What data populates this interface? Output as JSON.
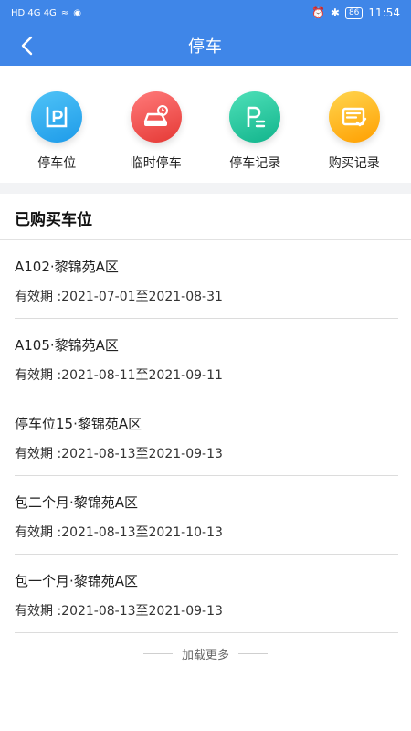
{
  "status_bar": {
    "network_left": "HD 4G 4G",
    "battery": "86",
    "time": "11:54"
  },
  "header": {
    "title": "停车"
  },
  "quick_actions": [
    {
      "label": "停车位",
      "icon": "parking-space-icon",
      "color": "#29b6f6"
    },
    {
      "label": "临时停车",
      "icon": "temp-parking-car-icon",
      "color": "#ef5350"
    },
    {
      "label": "停车记录",
      "icon": "parking-record-icon",
      "color": "#26c6a0"
    },
    {
      "label": "购买记录",
      "icon": "purchase-record-icon",
      "color": "#ffb300"
    }
  ],
  "section": {
    "title": "已购买车位"
  },
  "spaces": [
    {
      "name": "A102·黎锦苑A区",
      "period": "有效期 :2021-07-01至2021-08-31"
    },
    {
      "name": "A105·黎锦苑A区",
      "period": "有效期 :2021-08-11至2021-09-11"
    },
    {
      "name": "停车位15·黎锦苑A区",
      "period": "有效期 :2021-08-13至2021-09-13"
    },
    {
      "name": "包二个月·黎锦苑A区",
      "period": "有效期 :2021-08-13至2021-10-13"
    },
    {
      "name": "包一个月·黎锦苑A区",
      "period": "有效期 :2021-08-13至2021-09-13"
    }
  ],
  "footer": {
    "load_more": "加载更多"
  },
  "colors": {
    "header": "#3f86e8",
    "divider": "#dcdcdc"
  }
}
